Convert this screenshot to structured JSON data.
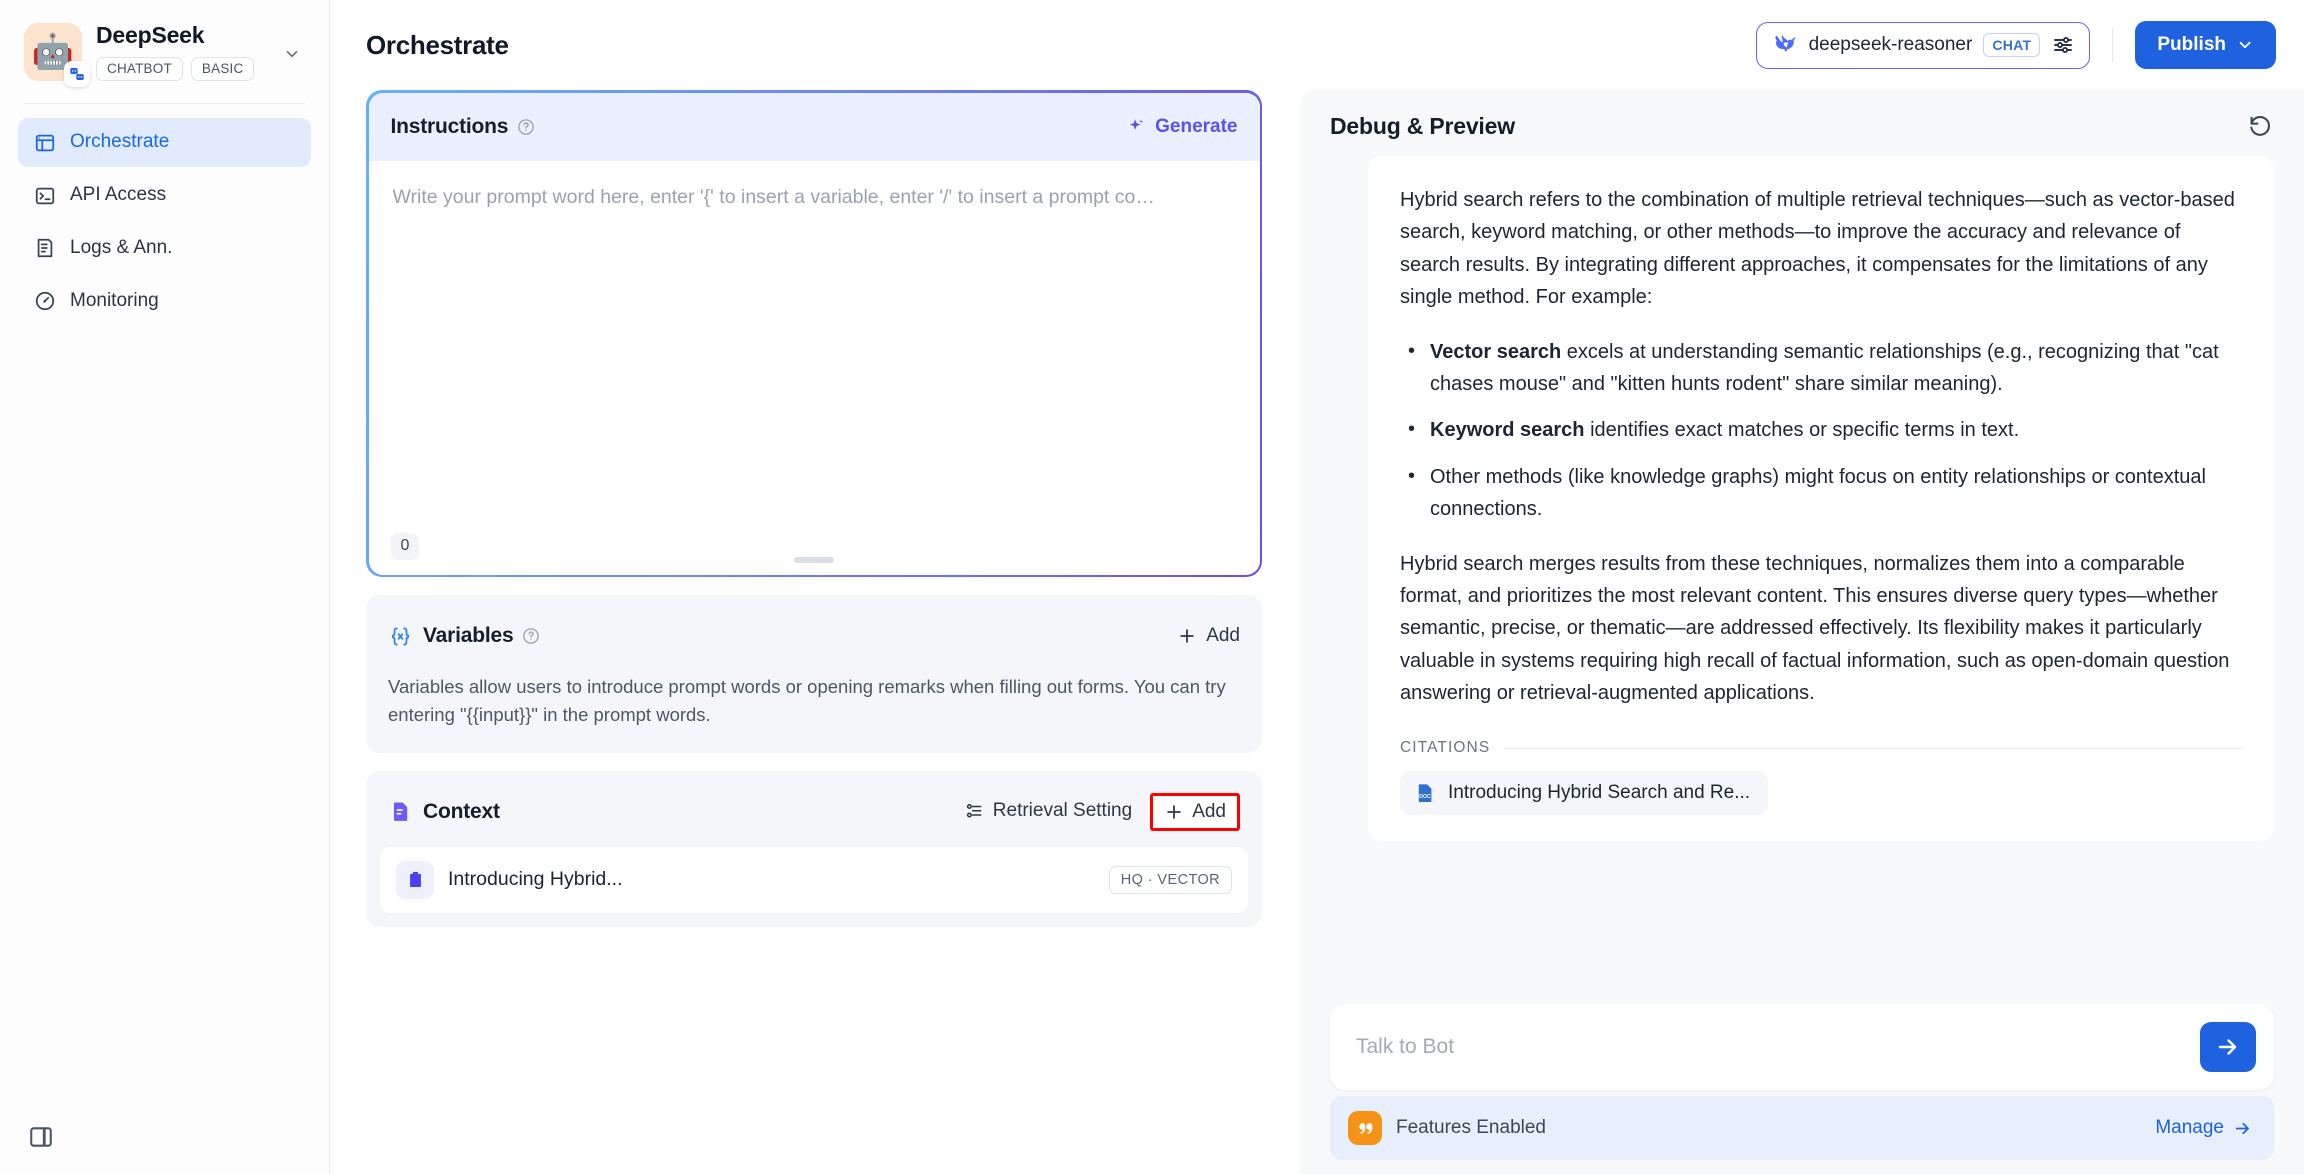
{
  "sidebar": {
    "brand": {
      "name": "DeepSeek",
      "avatar_emoji": "🤖",
      "tags": [
        "CHATBOT",
        "BASIC"
      ],
      "caret_icon": "chevron-down-icon",
      "badge_icon": "bot-type-icon"
    },
    "items": [
      {
        "label": "Orchestrate",
        "icon": "layout-panel-icon",
        "active": true
      },
      {
        "label": "API Access",
        "icon": "terminal-icon",
        "active": false
      },
      {
        "label": "Logs & Ann.",
        "icon": "document-list-icon",
        "active": false
      },
      {
        "label": "Monitoring",
        "icon": "gauge-icon",
        "active": false
      }
    ],
    "collapse_icon": "collapse-panel-icon"
  },
  "topbar": {
    "page_title": "Orchestrate",
    "model": {
      "icon": "deepseek-whale-icon",
      "name": "deepseek-reasoner",
      "badge": "CHAT",
      "settings_icon": "sliders-icon"
    },
    "publish_label": "Publish",
    "publish_caret_icon": "chevron-down-icon",
    "publish_color": "#1f62e0"
  },
  "instructions": {
    "title": "Instructions",
    "help_icon": "question-circle-icon",
    "generate_label": "Generate",
    "generate_icon": "sparkle-icon",
    "placeholder": "Write your prompt word here, enter '{' to insert a variable, enter '/' to insert a prompt co…",
    "value": "",
    "char_count": "0",
    "border_gradient_from": "#63b3f7",
    "border_gradient_to": "#6a4ef0",
    "resize_handle_icon": "drag-handle-icon"
  },
  "variables": {
    "title": "Variables",
    "icon": "variable-braces-icon",
    "help_icon": "question-circle-icon",
    "add_label": "Add",
    "add_icon": "plus-icon",
    "description": "Variables allow users to introduce prompt words or opening remarks when filling out forms. You can try entering \"{{input}}\" in the prompt words."
  },
  "context": {
    "title": "Context",
    "icon": "document-context-icon",
    "retrieval_label": "Retrieval Setting",
    "retrieval_icon": "retrieval-settings-icon",
    "add_label": "Add",
    "add_icon": "plus-icon",
    "add_highlight_color": "#ff0000",
    "items": [
      {
        "name": "Introducing Hybrid...",
        "icon": "knowledge-base-icon",
        "badge": "HQ · VECTOR"
      }
    ]
  },
  "debug": {
    "title": "Debug & Preview",
    "refresh_icon": "restart-icon",
    "message": {
      "paragraphs_top": [
        "Hybrid search refers to the combination of multiple retrieval techniques—such as vector-based search, keyword matching, or other methods—to improve the accuracy and relevance of search results. By integrating different approaches, it compensates for the limitations of any single method. For example:"
      ],
      "bullets": [
        {
          "lead": "Vector search",
          "rest": " excels at understanding semantic relationships (e.g., recognizing that \"cat chases mouse\" and \"kitten hunts rodent\" share similar meaning)."
        },
        {
          "lead": "Keyword search",
          "rest": " identifies exact matches or specific terms in text."
        },
        {
          "lead": "",
          "rest": "Other methods (like knowledge graphs) might focus on entity relationships or contextual connections."
        }
      ],
      "paragraphs_bottom": [
        "Hybrid search merges results from these techniques, normalizes them into a comparable format, and prioritizes the most relevant content. This ensures diverse query types—whether semantic, precise, or thematic—are addressed effectively. Its flexibility makes it particularly valuable in systems requiring high recall of factual information, such as open-domain question answering or retrieval-augmented applications."
      ]
    },
    "citations": {
      "label": "CITATIONS",
      "items": [
        {
          "title": "Introducing Hybrid Search and Re...",
          "icon": "docx-file-icon"
        }
      ]
    }
  },
  "chat": {
    "placeholder": "Talk to Bot",
    "value": "",
    "send_icon": "send-arrow-icon",
    "features": {
      "icon": "quote-feature-icon",
      "icon_color": "#f59217",
      "label": "Features Enabled",
      "manage_label": "Manage",
      "manage_icon": "arrow-right-icon"
    }
  }
}
